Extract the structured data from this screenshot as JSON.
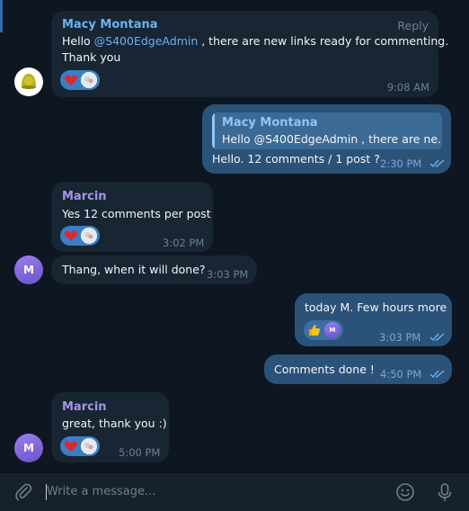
{
  "messages": [
    {
      "sender": "Macy Montana",
      "reply_label": "Reply",
      "text_prefix": "Hello ",
      "mention": "@S400EdgeAdmin",
      "text_suffix": " , there are new links ready for commenting.",
      "text_line2": "Thank you",
      "time": "9:08 AM"
    },
    {
      "quote_sender": "Macy Montana",
      "quote_text": "Hello @S400EdgeAdmin , there are ne...",
      "text": "Hello. 12 comments / 1 post ?",
      "time": "2:30 PM"
    },
    {
      "sender": "Marcin",
      "text": "Yes 12 comments per post",
      "time": "3:02 PM"
    },
    {
      "text": "Thang, when it will done?",
      "time": "3:03 PM"
    },
    {
      "text": "today M. Few hours more",
      "time": "3:03 PM",
      "reaction_avatar": "M"
    },
    {
      "text": "Comments done !",
      "time": "4:50 PM"
    },
    {
      "sender": "Marcin",
      "text": "great, thank you :)",
      "time": "5:00 PM"
    }
  ],
  "avatars": {
    "marcin_initial": "M"
  },
  "composer": {
    "placeholder": "Write a message..."
  },
  "colors": {
    "background": "#0e1621",
    "incoming_bubble": "#182533",
    "outgoing_bubble": "#2b5278",
    "macy_name": "#6ab3f3",
    "marcin_name": "#a695e7",
    "mention": "#6ab3f3",
    "reaction_pill": "#3a7ec3",
    "composer_bg": "#17212b"
  },
  "icons": [
    "attach-icon",
    "emoji-icon",
    "microphone-icon",
    "heart-icon",
    "thumbs-up-icon",
    "double-check-icon"
  ]
}
